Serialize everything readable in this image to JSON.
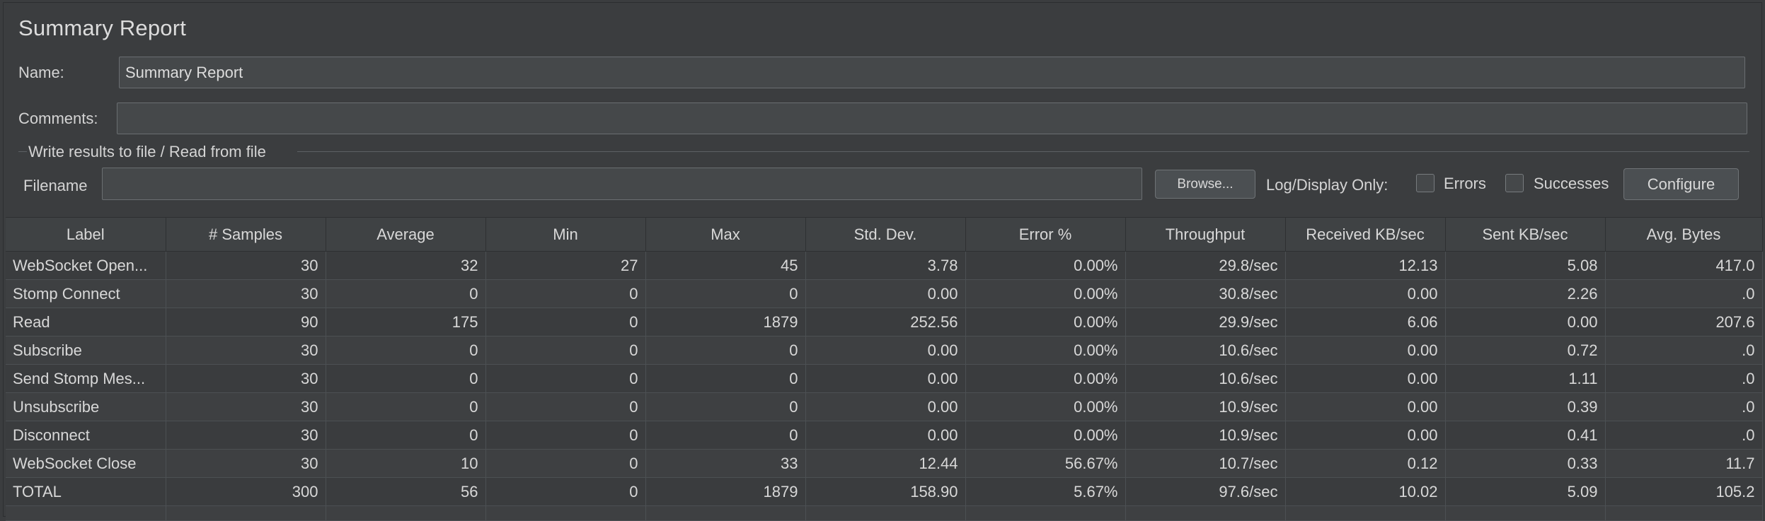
{
  "panel": {
    "title": "Summary Report",
    "name_label": "Name:",
    "name_value": "Summary Report",
    "comments_label": "Comments:",
    "comments_value": "",
    "file_group_label": "Write results to file / Read from file",
    "filename_label": "Filename",
    "filename_value": "",
    "browse_label": "Browse...",
    "log_display_label": "Log/Display Only:",
    "errors_label": "Errors",
    "errors_checked": false,
    "successes_label": "Successes",
    "successes_checked": false,
    "configure_label": "Configure"
  },
  "table": {
    "columns": [
      "Label",
      "# Samples",
      "Average",
      "Min",
      "Max",
      "Std. Dev.",
      "Error %",
      "Throughput",
      "Received KB/sec",
      "Sent KB/sec",
      "Avg. Bytes"
    ],
    "rows": [
      [
        "WebSocket Open...",
        "30",
        "32",
        "27",
        "45",
        "3.78",
        "0.00%",
        "29.8/sec",
        "12.13",
        "5.08",
        "417.0"
      ],
      [
        "Stomp Connect",
        "30",
        "0",
        "0",
        "0",
        "0.00",
        "0.00%",
        "30.8/sec",
        "0.00",
        "2.26",
        ".0"
      ],
      [
        "Read",
        "90",
        "175",
        "0",
        "1879",
        "252.56",
        "0.00%",
        "29.9/sec",
        "6.06",
        "0.00",
        "207.6"
      ],
      [
        "Subscribe",
        "30",
        "0",
        "0",
        "0",
        "0.00",
        "0.00%",
        "10.6/sec",
        "0.00",
        "0.72",
        ".0"
      ],
      [
        "Send Stomp Mes...",
        "30",
        "0",
        "0",
        "0",
        "0.00",
        "0.00%",
        "10.6/sec",
        "0.00",
        "1.11",
        ".0"
      ],
      [
        "Unsubscribe",
        "30",
        "0",
        "0",
        "0",
        "0.00",
        "0.00%",
        "10.9/sec",
        "0.00",
        "0.39",
        ".0"
      ],
      [
        "Disconnect",
        "30",
        "0",
        "0",
        "0",
        "0.00",
        "0.00%",
        "10.9/sec",
        "0.00",
        "0.41",
        ".0"
      ],
      [
        "WebSocket Close",
        "30",
        "10",
        "0",
        "33",
        "12.44",
        "56.67%",
        "10.7/sec",
        "0.12",
        "0.33",
        "11.7"
      ],
      [
        "TOTAL",
        "300",
        "56",
        "0",
        "1879",
        "158.90",
        "5.67%",
        "97.6/sec",
        "10.02",
        "5.09",
        "105.2"
      ]
    ]
  }
}
